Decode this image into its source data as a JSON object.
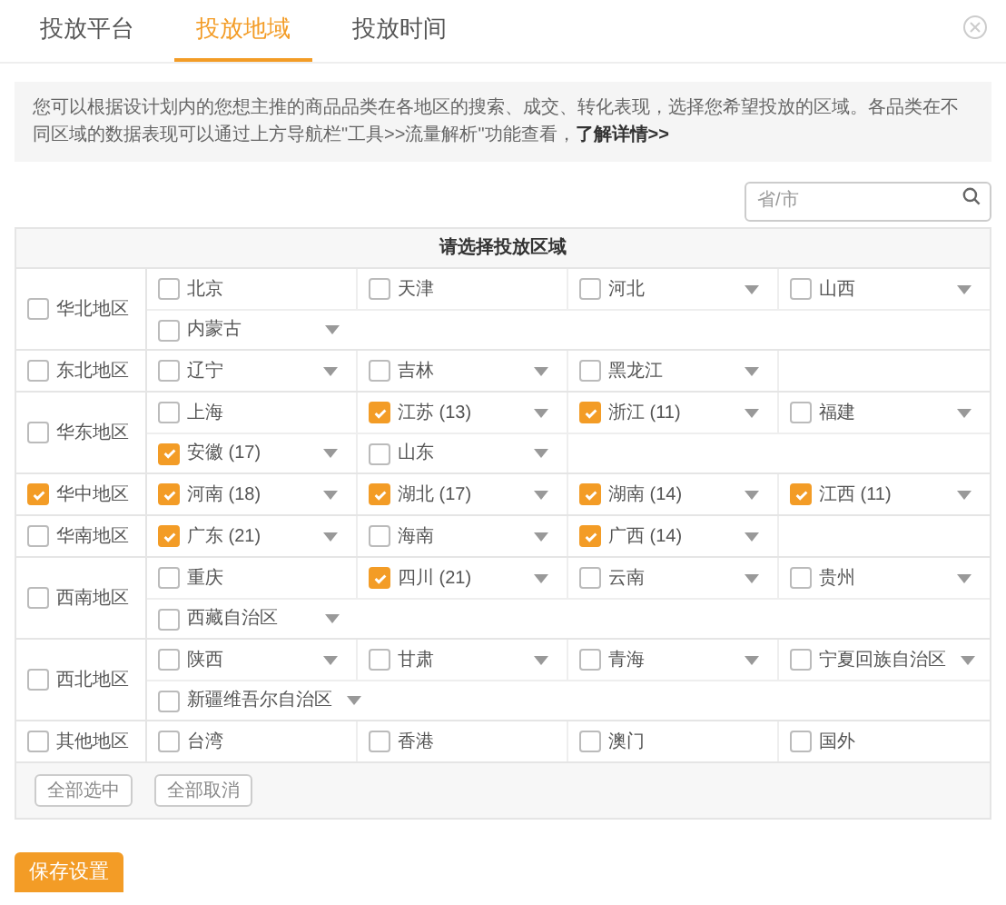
{
  "tabs": [
    {
      "label": "投放平台",
      "selected": false
    },
    {
      "label": "投放地域",
      "selected": true
    },
    {
      "label": "投放时间",
      "selected": false
    }
  ],
  "notice": {
    "text": "您可以根据设计划内的您想主推的商品品类在各地区的搜索、成交、转化表现，选择您希望投放的区域。各品类在不同区域的数据表现可以通过上方导航栏\"工具>>流量解析\"功能查看，",
    "link": "了解详情>>"
  },
  "search": {
    "placeholder": "省/市"
  },
  "table": {
    "title": "请选择投放区域",
    "regions": [
      {
        "name": "华北地区",
        "checked": false,
        "lines": [
          {
            "provinces": [
              {
                "name": "北京",
                "checked": false,
                "expandable": false
              },
              {
                "name": "天津",
                "checked": false,
                "expandable": false
              },
              {
                "name": "河北",
                "checked": false,
                "expandable": true
              },
              {
                "name": "山西",
                "checked": false,
                "expandable": true
              }
            ]
          },
          {
            "provinces": [
              {
                "name": "内蒙古",
                "checked": false,
                "expandable": true
              }
            ]
          }
        ]
      },
      {
        "name": "东北地区",
        "checked": false,
        "lines": [
          {
            "provinces": [
              {
                "name": "辽宁",
                "checked": false,
                "expandable": true
              },
              {
                "name": "吉林",
                "checked": false,
                "expandable": true
              },
              {
                "name": "黑龙江",
                "checked": false,
                "expandable": true
              }
            ]
          }
        ]
      },
      {
        "name": "华东地区",
        "checked": false,
        "lines": [
          {
            "provinces": [
              {
                "name": "上海",
                "checked": false,
                "expandable": false
              },
              {
                "name": "江苏 (13)",
                "checked": true,
                "expandable": true
              },
              {
                "name": "浙江 (11)",
                "checked": true,
                "expandable": true
              },
              {
                "name": "福建",
                "checked": false,
                "expandable": true
              }
            ]
          },
          {
            "provinces": [
              {
                "name": "安徽 (17)",
                "checked": true,
                "expandable": true
              },
              {
                "name": "山东",
                "checked": false,
                "expandable": true
              }
            ]
          }
        ]
      },
      {
        "name": "华中地区",
        "checked": true,
        "lines": [
          {
            "provinces": [
              {
                "name": "河南 (18)",
                "checked": true,
                "expandable": true
              },
              {
                "name": "湖北 (17)",
                "checked": true,
                "expandable": true
              },
              {
                "name": "湖南 (14)",
                "checked": true,
                "expandable": true
              },
              {
                "name": "江西 (11)",
                "checked": true,
                "expandable": true
              }
            ]
          }
        ]
      },
      {
        "name": "华南地区",
        "checked": false,
        "lines": [
          {
            "provinces": [
              {
                "name": "广东 (21)",
                "checked": true,
                "expandable": true
              },
              {
                "name": "海南",
                "checked": false,
                "expandable": true
              },
              {
                "name": "广西 (14)",
                "checked": true,
                "expandable": true
              }
            ]
          }
        ]
      },
      {
        "name": "西南地区",
        "checked": false,
        "lines": [
          {
            "provinces": [
              {
                "name": "重庆",
                "checked": false,
                "expandable": false
              },
              {
                "name": "四川 (21)",
                "checked": true,
                "expandable": true
              },
              {
                "name": "云南",
                "checked": false,
                "expandable": true
              },
              {
                "name": "贵州",
                "checked": false,
                "expandable": true
              }
            ]
          },
          {
            "provinces": [
              {
                "name": "西藏自治区",
                "checked": false,
                "expandable": true
              }
            ]
          }
        ]
      },
      {
        "name": "西北地区",
        "checked": false,
        "lines": [
          {
            "provinces": [
              {
                "name": "陕西",
                "checked": false,
                "expandable": true
              },
              {
                "name": "甘肃",
                "checked": false,
                "expandable": true
              },
              {
                "name": "青海",
                "checked": false,
                "expandable": true
              },
              {
                "name": "宁夏回族自治区",
                "checked": false,
                "expandable": true
              }
            ]
          },
          {
            "provinces": [
              {
                "name": "新疆维吾尔自治区",
                "checked": false,
                "expandable": true
              }
            ]
          }
        ]
      },
      {
        "name": "其他地区",
        "checked": false,
        "lines": [
          {
            "provinces": [
              {
                "name": "台湾",
                "checked": false,
                "expandable": false
              },
              {
                "name": "香港",
                "checked": false,
                "expandable": false
              },
              {
                "name": "澳门",
                "checked": false,
                "expandable": false
              },
              {
                "name": "国外",
                "checked": false,
                "expandable": false
              }
            ]
          }
        ]
      }
    ],
    "buttons": [
      "全部选中",
      "全部取消"
    ]
  },
  "save_button": "保存设置"
}
